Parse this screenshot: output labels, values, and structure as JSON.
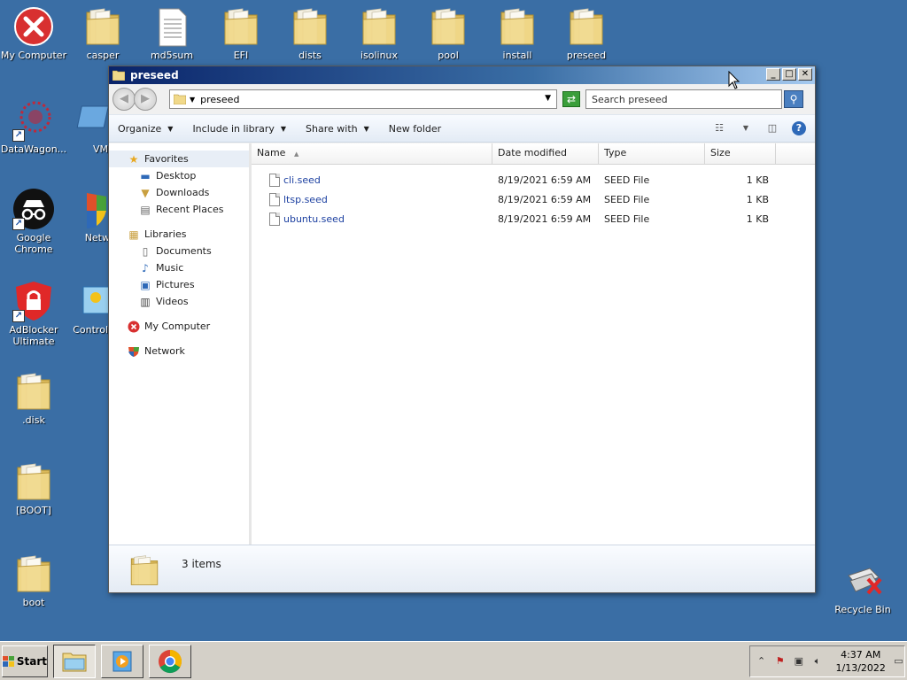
{
  "desktop": {
    "icons": {
      "my_computer": "My Computer",
      "casper": "casper",
      "md5sum": "md5sum",
      "efi": "EFI",
      "dists": "dists",
      "isolinux": "isolinux",
      "pool": "pool",
      "install": "install",
      "preseed": "preseed",
      "datawagon": "DataWagon...",
      "vm": "VM",
      "google_chrome": "Google Chrome",
      "network": "Netw",
      "adblocker": "AdBlocker Ultimate",
      "control": "Control",
      "disk": ".disk",
      "boot_bracket": "[BOOT]",
      "boot": "boot",
      "recycle_bin": "Recycle Bin"
    }
  },
  "window": {
    "title": "preseed",
    "buttons": {
      "minimize": "_",
      "maximize": "□",
      "close": "✕"
    },
    "address": {
      "path": "preseed",
      "search_placeholder": "Search preseed"
    },
    "toolbar": {
      "organize": "Organize",
      "include_in_library": "Include in library",
      "share_with": "Share with",
      "new_folder": "New folder"
    },
    "navpane": {
      "favorites": "Favorites",
      "desktop": "Desktop",
      "downloads": "Downloads",
      "recent_places": "Recent Places",
      "libraries": "Libraries",
      "documents": "Documents",
      "music": "Music",
      "pictures": "Pictures",
      "videos": "Videos",
      "my_computer": "My Computer",
      "network": "Network"
    },
    "columns": {
      "name": "Name",
      "date_modified": "Date modified",
      "type": "Type",
      "size": "Size"
    },
    "files": [
      {
        "name": "cli.seed",
        "date": "8/19/2021 6:59 AM",
        "type": "SEED File",
        "size": "1 KB"
      },
      {
        "name": "ltsp.seed",
        "date": "8/19/2021 6:59 AM",
        "type": "SEED File",
        "size": "1 KB"
      },
      {
        "name": "ubuntu.seed",
        "date": "8/19/2021 6:59 AM",
        "type": "SEED File",
        "size": "1 KB"
      }
    ],
    "details": {
      "count": "3 items"
    }
  },
  "taskbar": {
    "start": "Start",
    "time": "4:37 AM",
    "date": "1/13/2022"
  },
  "colors": {
    "desktop_bg": "#3a6ea5",
    "link_blue": "#1b3fa0"
  }
}
